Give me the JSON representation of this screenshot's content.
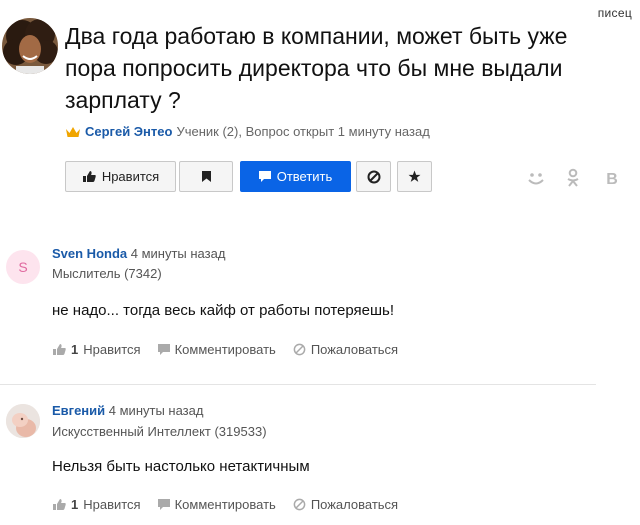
{
  "watermark": "писец",
  "question": {
    "title": "Два года работаю в компании, может быть уже пора попросить директора что бы мне выдали зарплату ?",
    "author": "Сергей Энтео",
    "meta": "Ученик (2), Вопрос открыт 1 минуту назад",
    "colors": {
      "author": "#1a5aa8",
      "crown": "#f0a500"
    }
  },
  "toolbar": {
    "like_label": "Нравится",
    "answer_label": "Ответить",
    "icons": [
      "thumb-up-icon",
      "bookmark-icon",
      "comment-icon",
      "block-icon",
      "star-icon"
    ],
    "colors": {
      "primary": "#0a64e6"
    }
  },
  "share": {
    "icons": [
      "odnoklassniki-smile-icon",
      "odnoklassniki-icon",
      "vk-icon"
    ]
  },
  "answers": [
    {
      "avatar_letter": "S",
      "name": "Sven Honda",
      "time": "4 минуты назад",
      "rank": "Мыслитель (7342)",
      "text": "не надо... тогда весь кайф от работы потеряешь!",
      "likes": "1",
      "like_label": "Нравится",
      "comment_label": "Комментировать",
      "report_label": "Пожаловаться"
    },
    {
      "avatar_letter": "",
      "name": "Евгений",
      "time": "4 минуты назад",
      "rank": "Искусственный Интеллект (319533)",
      "text": "Нельзя быть настолько нетактичным",
      "likes": "1",
      "like_label": "Нравится",
      "comment_label": "Комментировать",
      "report_label": "Пожаловаться"
    }
  ]
}
